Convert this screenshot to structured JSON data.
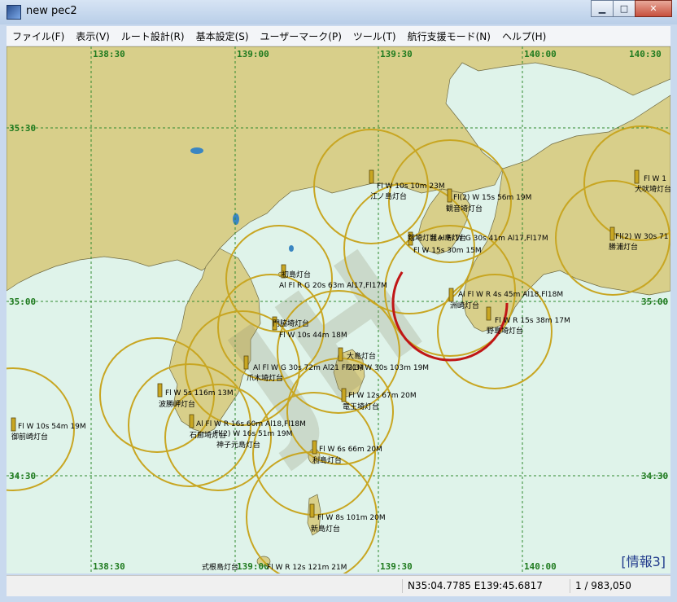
{
  "window": {
    "title": "new pec2"
  },
  "menu": [
    "ファイル(F)",
    "表示(V)",
    "ルート設計(R)",
    "基本設定(S)",
    "ユーザーマーク(P)",
    "ツール(T)",
    "航行支援モード(N)",
    "ヘルプ(H)"
  ],
  "map": {
    "lon_top": [
      "138:30",
      "139:00",
      "139:30",
      "140:00",
      "140:30"
    ],
    "lon_bottom": [
      "138:30",
      "139:00",
      "139:30",
      "140:00"
    ],
    "lat_left": [
      "35:30",
      "35:00",
      "34:30"
    ],
    "lat_right": [
      "35:00",
      "34:30"
    ],
    "lights": [
      {
        "name": "江ノ島灯台",
        "char": "Fl W 10s 10m 23M"
      },
      {
        "name": "観音埼灯台",
        "char": "Fl(2) W 15s 56m 19M"
      },
      {
        "name": "剱埼灯台",
        "char": "Al Fl W G 30s 41m Al17,Fl17M"
      },
      {
        "name": "城ヶ島灯台",
        "char": "Fl W 15s 30m 15M"
      },
      {
        "name": "初島灯台",
        "char": "Al Fl R G 20s 63m Al17,Fl17M"
      },
      {
        "name": "洲崎灯台",
        "char": "Al Fl W R 4s 45m Al18,Fl18M"
      },
      {
        "name": "野島埼灯台",
        "char": "Fl W R 15s 38m 17M"
      },
      {
        "name": "門脇埼灯台",
        "char": "Fl W 10s 44m 18M"
      },
      {
        "name": "爪木埼灯台",
        "char": "Al Fl W G 30s 72m Al21 Fl21M"
      },
      {
        "name": "石廊埼灯台",
        "char": "Al Fl W R 16s 60m Al18,Fl18M"
      },
      {
        "name": "大島灯台",
        "char": "Fl(3) W 30s 103m 19M"
      },
      {
        "name": "波勝岬灯台",
        "char": "Fl W 5s 116m 13M"
      },
      {
        "name": "御前崎灯台",
        "char": "Fl W 10s 54m 19M"
      },
      {
        "name": "神子元島灯台",
        "char": "Fl(2) W 16s 51m 19M"
      },
      {
        "name": "竜王埼灯台",
        "char": "Fl W 12s 67m 20M"
      },
      {
        "name": "利島灯台",
        "char": "Fl W 6s 66m 20M"
      },
      {
        "name": "新島灯台",
        "char": "Fl W 8s 101m 20M"
      },
      {
        "name": "式根島灯台",
        "char": "Fl W R 12s 121m 21M"
      },
      {
        "name": "犬吠埼灯台",
        "char": "Fl W 1"
      },
      {
        "name": "勝浦灯台",
        "char": "Fl(2) W 30s 71"
      }
    ],
    "colors": {
      "land": "#d8cf8a",
      "sea": "#dff3ea",
      "grid": "#2f8a2f",
      "range_ring": "#c8a622",
      "selected_ring": "#c01616"
    },
    "info_badge": "[情報3]"
  },
  "status": {
    "empty": "",
    "coords": "N35:04.7785 E139:45.6817",
    "scale": "1 / 983,050"
  }
}
